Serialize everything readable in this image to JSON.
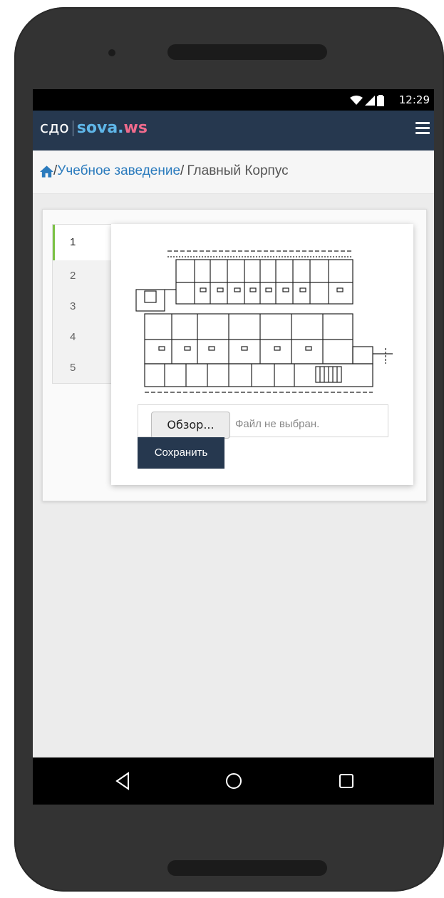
{
  "status_bar": {
    "time": "12:29"
  },
  "header": {
    "logo_prefix": "сдо",
    "logo_brand_1": "sova.",
    "logo_brand_2": "ws"
  },
  "breadcrumb": {
    "item_1": "Учебное заведение",
    "separator": "/",
    "current": "Главный Корпус"
  },
  "floor_tabs": [
    "1",
    "2",
    "3",
    "4",
    "5"
  ],
  "active_tab": "1",
  "file_upload": {
    "browse_label": "Обзор...",
    "status_text": "Файл не выбран."
  },
  "save_button": {
    "label": "Сохранить"
  },
  "colors": {
    "navbar": "#26384f",
    "brand_blue": "#5fb6e8",
    "brand_pink": "#f06b8d",
    "link": "#2b7bbd",
    "active_tab_accent": "#7cc245"
  }
}
